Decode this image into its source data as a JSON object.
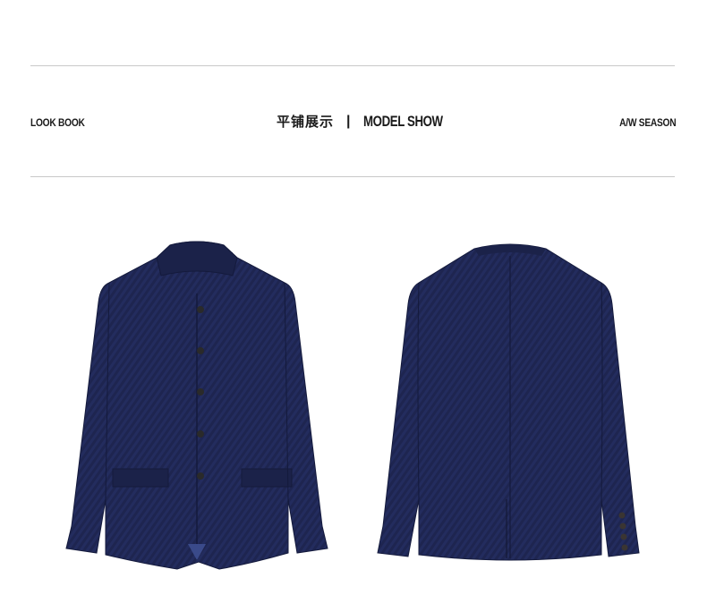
{
  "header": {
    "left_label": "LOOK BOOK",
    "center_cn": "平铺展示",
    "separator": "|",
    "center_en": "MODEL SHOW",
    "right_label": "A/W SEASON"
  },
  "gallery": {
    "front_image": "jacket-front-photo",
    "back_image": "jacket-back-photo"
  },
  "colors": {
    "jacket": "#1e2550",
    "jacket_dark": "#141a3c",
    "lining": "#3a4a8a",
    "rule": "#c9c9c9",
    "button": "#2a2a2a"
  }
}
